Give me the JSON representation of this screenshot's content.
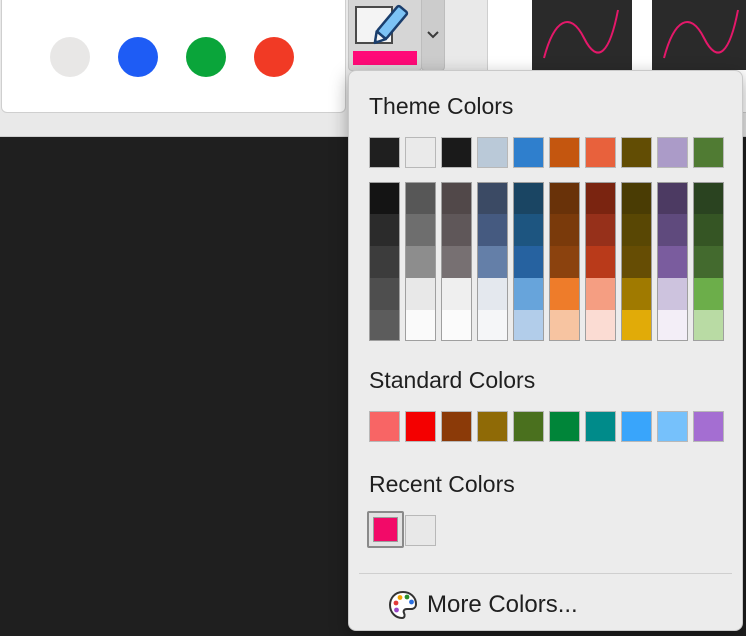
{
  "ribbon": {
    "pen_colors": [
      {
        "name": "light-gray",
        "color": "#e8e7e6"
      },
      {
        "name": "blue",
        "color": "#1e5cf5"
      },
      {
        "name": "green",
        "color": "#0aa53a"
      },
      {
        "name": "red",
        "color": "#f13a25"
      }
    ],
    "current_pen_color": "#ff0a78",
    "stroke_color": "#e4186a"
  },
  "popup": {
    "theme_title": "Theme Colors",
    "theme_top": [
      "#1f1f1f",
      "#eaeaea",
      "#1a1a1a",
      "#bac9d8",
      "#2f7fcd",
      "#c4560f",
      "#e8613c",
      "#624d04",
      "#ab9bc8",
      "#507b33"
    ],
    "theme_shades": [
      [
        "#141414",
        "#2b2b2b",
        "#3c3c3c",
        "#4e4e4e",
        "#5c5c5c"
      ],
      [
        "#575757",
        "#6e6e6e",
        "#8d8d8d",
        "#e8e8e8",
        "#fafafa"
      ],
      [
        "#514849",
        "#5f5759",
        "#777072",
        "#efefef",
        "#fbfbfb"
      ],
      [
        "#3b4a64",
        "#455a80",
        "#647fa8",
        "#e4e8ee",
        "#f5f6f8"
      ],
      [
        "#1a4563",
        "#1d5580",
        "#2662a0",
        "#67a4db",
        "#b2cdea"
      ],
      [
        "#693209",
        "#7a3a0b",
        "#8b420e",
        "#ee7c2a",
        "#f7c4a1"
      ],
      [
        "#7a2410",
        "#96301a",
        "#b93a1a",
        "#f59e82",
        "#fbdcd3"
      ],
      [
        "#4a3c04",
        "#594704",
        "#664d04",
        "#a07a00",
        "#e1ab08"
      ],
      [
        "#4c3a62",
        "#5f4a7d",
        "#7a5c9e",
        "#cdc3de",
        "#f3eef7"
      ],
      [
        "#2a4320",
        "#355524",
        "#436a2e",
        "#6cae4a",
        "#b9dba4"
      ]
    ],
    "standard_title": "Standard Colors",
    "standard": [
      "#f86565",
      "#f40000",
      "#8b3a08",
      "#8f6a06",
      "#4a701e",
      "#008539",
      "#008b8a",
      "#39a5fb",
      "#76c1fb",
      "#a46ed2"
    ],
    "recent_title": "Recent Colors",
    "recent": [
      "#f20a68",
      "#e8e8e8"
    ],
    "more_colors_label": "More Colors..."
  }
}
